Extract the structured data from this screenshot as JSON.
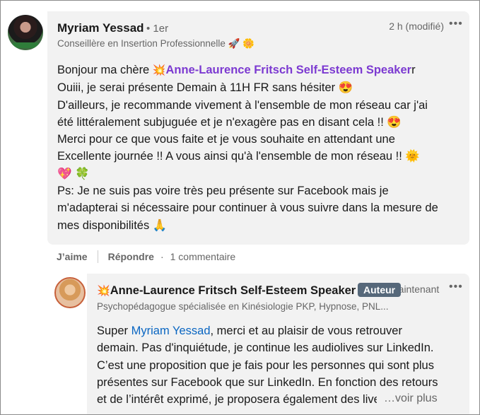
{
  "comment": {
    "author": "Myriam Yessad",
    "degree": "• 1er",
    "headline": "Conseillère en Insertion Professionnelle 🚀 🌼",
    "time": "2 h (modifié)",
    "more": "•••",
    "greeting": "Bonjour ma chère ",
    "mention_icon": "💥",
    "mention": "Anne-Laurence Fritsch Self-Esteem Speaker",
    "mention_tail": "r",
    "lines": [
      "Ouiii, je serai présente Demain à 11H FR sans hésiter 😍",
      "D'ailleurs, je recommande vivement à l'ensemble de mon réseau car j'ai",
      "été littéralement subjuguée et je n'exagère pas en disant cela !! 😍",
      "Merci pour ce que vous faite et je vous souhaite en attendant une",
      "Excellente journée !! A vous ainsi qu'à l'ensemble de mon réseau !! 🌞",
      "💖 🍀",
      "Ps: Je ne suis pas voire très peu présente sur Facebook mais je",
      "m'adapterai si nécessaire pour continuer à vous suivre dans la mesure de",
      "mes disponibilités 🙏"
    ]
  },
  "actions": {
    "like": "J’aime",
    "reply": "Répondre",
    "dot": "·",
    "replies_count": "1 commentaire"
  },
  "reply": {
    "name_icon": "💥",
    "author": "Anne-Laurence Fritsch Self-Esteem Speaker",
    "badge": "Auteur",
    "time": "maintenant",
    "more": "•••",
    "headline": "Psychopédagogue spécialisée en Kinésiologie PKP, Hypnose, PNL...",
    "intro": "Super ",
    "mention": "Myriam Yessad",
    "first_line_rest": ", merci et au plaisir de vous retrouver",
    "lines": [
      "demain. Pas d'inquiétude, je continue les audiolives sur LinkedIn.",
      "C’est une proposition que je fais pour les personnes qui sont plus",
      "présentes sur Facebook que sur LinkedIn. En fonction des retours",
      "et de l’intérêt exprimé, je proposera également des live"
    ],
    "see_more": "…voir plus"
  }
}
